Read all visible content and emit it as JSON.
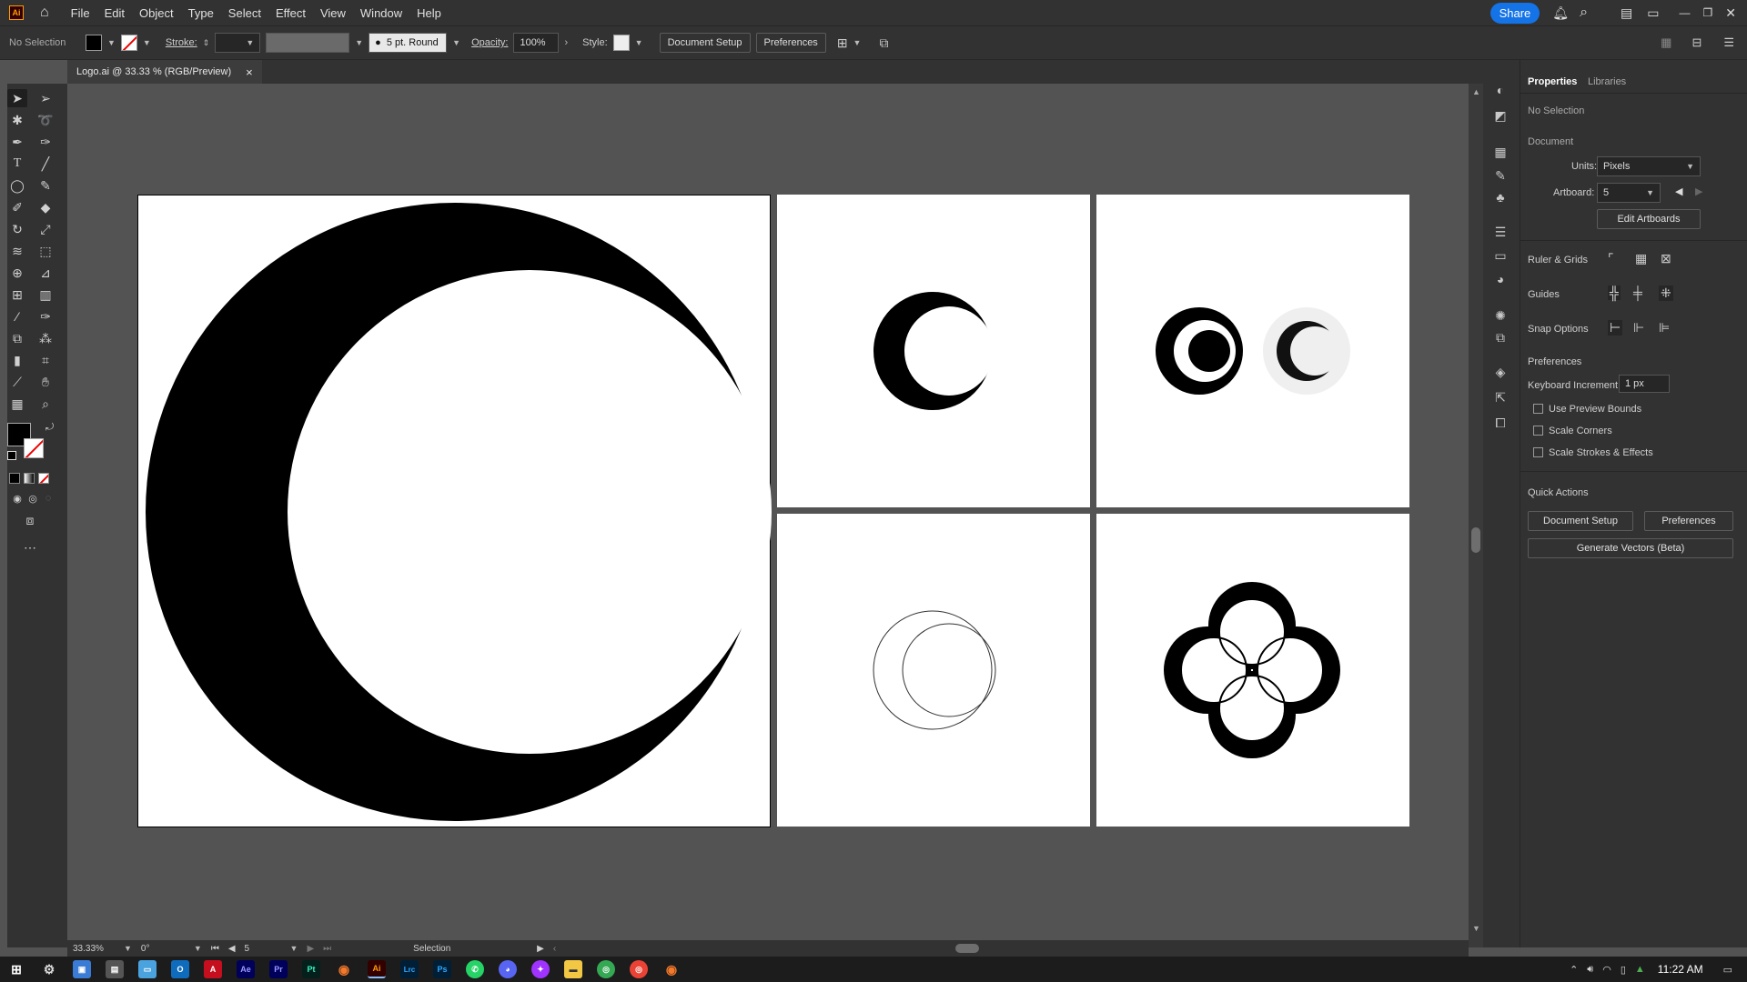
{
  "app": {
    "logo_text": "Ai"
  },
  "menu": {
    "items": [
      "File",
      "Edit",
      "Object",
      "Type",
      "Select",
      "Effect",
      "View",
      "Window",
      "Help"
    ],
    "share_label": "Share"
  },
  "control_bar": {
    "selection": "No Selection",
    "stroke_label": "Stroke:",
    "brush": "5 pt. Round",
    "opacity_label": "Opacity:",
    "opacity_value": "100%",
    "style_label": "Style:",
    "doc_setup": "Document Setup",
    "preferences": "Preferences"
  },
  "document_tab": {
    "title": "Logo.ai @ 33.33 % (RGB/Preview)",
    "close": "×"
  },
  "status_bar": {
    "zoom": "33.33%",
    "rotation": "0°",
    "artboard": "5",
    "tool": "Selection"
  },
  "panel": {
    "tabs": [
      "Properties",
      "Libraries"
    ],
    "selection": "No Selection",
    "document_header": "Document",
    "units_label": "Units:",
    "units_value": "Pixels",
    "artboard_label": "Artboard:",
    "artboard_value": "5",
    "edit_artboards": "Edit Artboards",
    "ruler_grids": "Ruler & Grids",
    "guides": "Guides",
    "snap_options": "Snap Options",
    "preferences_header": "Preferences",
    "keyboard_increment_label": "Keyboard Increment:",
    "keyboard_increment_value": "1 px",
    "checkboxes": [
      "Use Preview Bounds",
      "Scale Corners",
      "Scale Strokes & Effects"
    ],
    "quick_actions": "Quick Actions",
    "qa_doc_setup": "Document Setup",
    "qa_preferences": "Preferences",
    "generate_vectors": "Generate Vectors (Beta)"
  },
  "taskbar": {
    "clock": "11:22 AM",
    "apps": [
      "Ae",
      "Pr",
      "Pt",
      "Ai",
      "Lrc",
      "Ps"
    ]
  },
  "colors": {
    "accent": "#1473e6",
    "ui_dark": "#323232",
    "canvas": "#535353",
    "ai_orange": "#ff9a00"
  }
}
